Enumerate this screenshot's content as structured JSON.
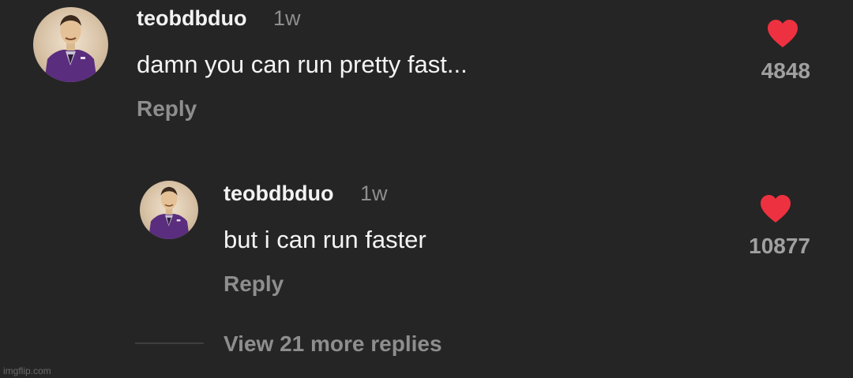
{
  "comment": {
    "username": "teobdbduo",
    "time": "1w",
    "text": "damn you can run pretty fast...",
    "reply_label": "Reply",
    "likes": "4848",
    "avatar_icon": "suited-figure-avatar"
  },
  "reply": {
    "username": "teobdbduo",
    "time": "1w",
    "text": "but i can run faster",
    "reply_label": "Reply",
    "likes": "10877",
    "avatar_icon": "suited-figure-avatar"
  },
  "view_more_label": "View 21 more replies",
  "watermark": "imgflip.com",
  "colors": {
    "background": "#252525",
    "heart": "#ee3140",
    "secondary_text": "#8e8e8e"
  }
}
